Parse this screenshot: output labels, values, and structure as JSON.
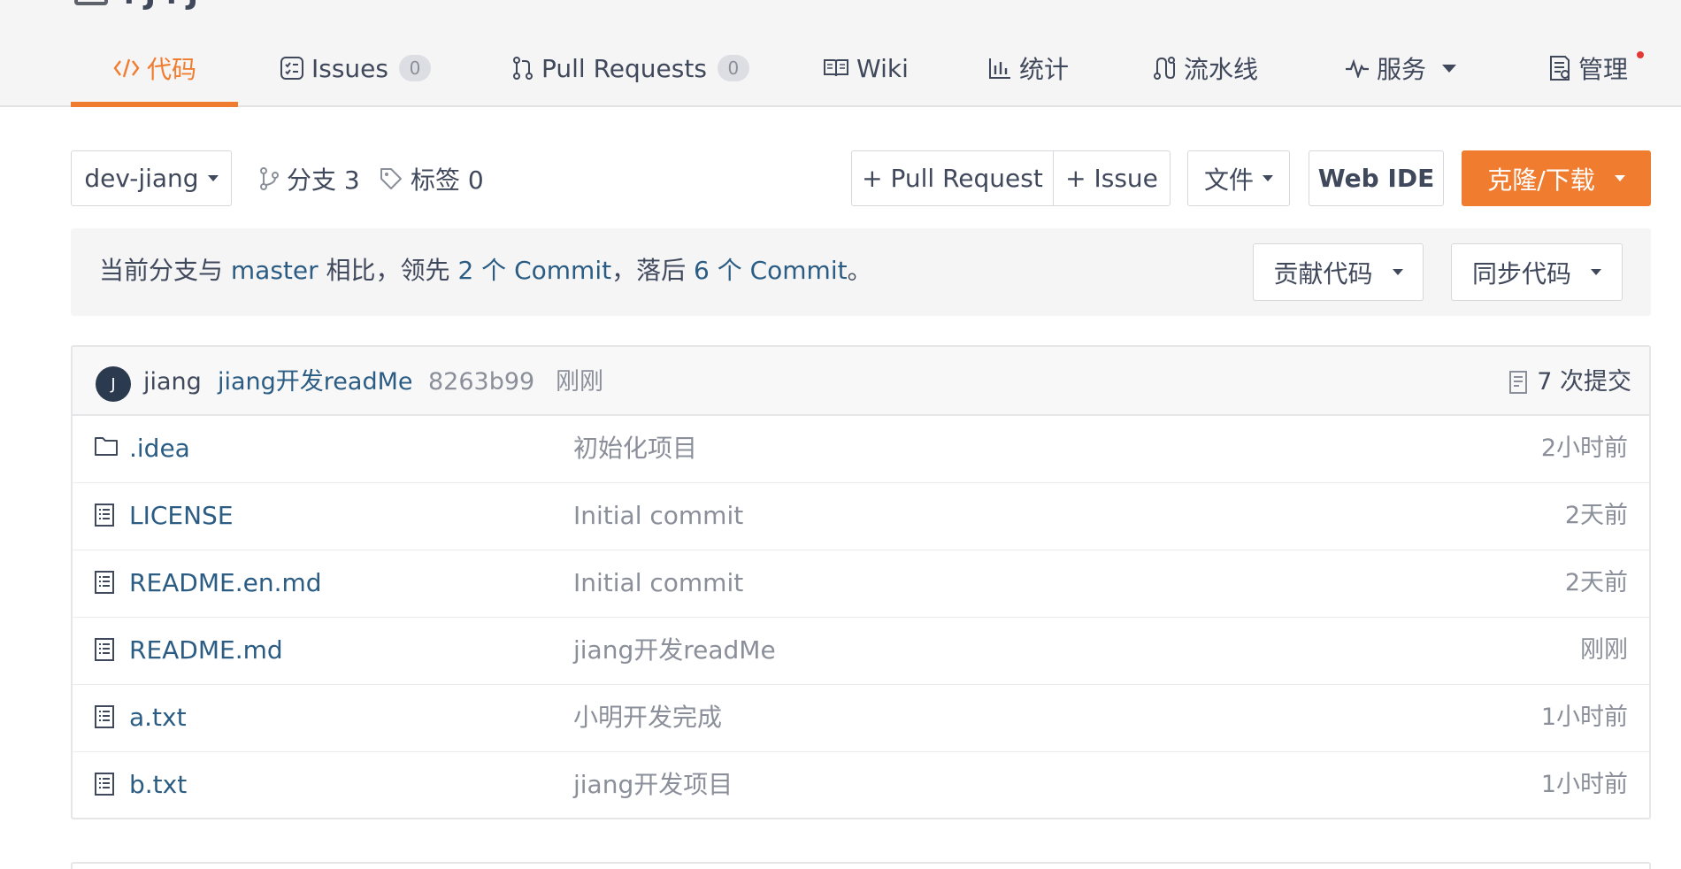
{
  "nav": {
    "tabs": [
      {
        "label": "代码",
        "icon": "code-icon"
      },
      {
        "label": "Issues",
        "badge": "0",
        "icon": "issues-icon"
      },
      {
        "label": "Pull Requests",
        "badge": "0",
        "icon": "pull-request-icon"
      },
      {
        "label": "Wiki",
        "icon": "wiki-icon"
      },
      {
        "label": "统计",
        "icon": "stats-icon"
      },
      {
        "label": "流水线",
        "icon": "pipeline-icon"
      },
      {
        "label": "服务",
        "icon": "pulse-icon"
      },
      {
        "label": "管理",
        "icon": "manage-icon"
      }
    ],
    "active_index": 0
  },
  "toolbar": {
    "branch": "dev-jiang",
    "branches_label": "分支 3",
    "tags_label": "标签 0",
    "pull_request_button": "+ Pull Request",
    "issue_button": "+ Issue",
    "file_button": "文件",
    "webide_button": "Web IDE",
    "clone_button": "克隆/下载"
  },
  "compare": {
    "prefix": "当前分支与 ",
    "base_branch": "master",
    "middle1": " 相比，领先 ",
    "ahead": "2 个 Commit",
    "middle2": "，落后 ",
    "behind": "6 个 Commit",
    "suffix": "。",
    "contribute_button": "贡献代码",
    "sync_button": "同步代码"
  },
  "latest_commit": {
    "avatar_initial": "J",
    "author": "jiang",
    "message": "jiang开发readMe",
    "sha": "8263b99",
    "time": "刚刚",
    "commit_count": "7 次提交"
  },
  "files": [
    {
      "name": ".idea",
      "type": "folder",
      "message": "初始化项目",
      "time": "2小时前"
    },
    {
      "name": "LICENSE",
      "type": "file",
      "message": "Initial commit",
      "time": "2天前"
    },
    {
      "name": "README.en.md",
      "type": "file",
      "message": "Initial commit",
      "time": "2天前"
    },
    {
      "name": "README.md",
      "type": "file",
      "message": "jiang开发readMe",
      "time": "刚刚"
    },
    {
      "name": "a.txt",
      "type": "file",
      "message": "小明开发完成",
      "time": "1小时前"
    },
    {
      "name": "b.txt",
      "type": "file",
      "message": "jiang开发项目",
      "time": "1小时前"
    }
  ],
  "colors": {
    "accent": "#f07c2f",
    "link": "#2b5c83",
    "muted": "#8a8f99",
    "text": "#40485b",
    "notify_dot": "#e53935"
  }
}
